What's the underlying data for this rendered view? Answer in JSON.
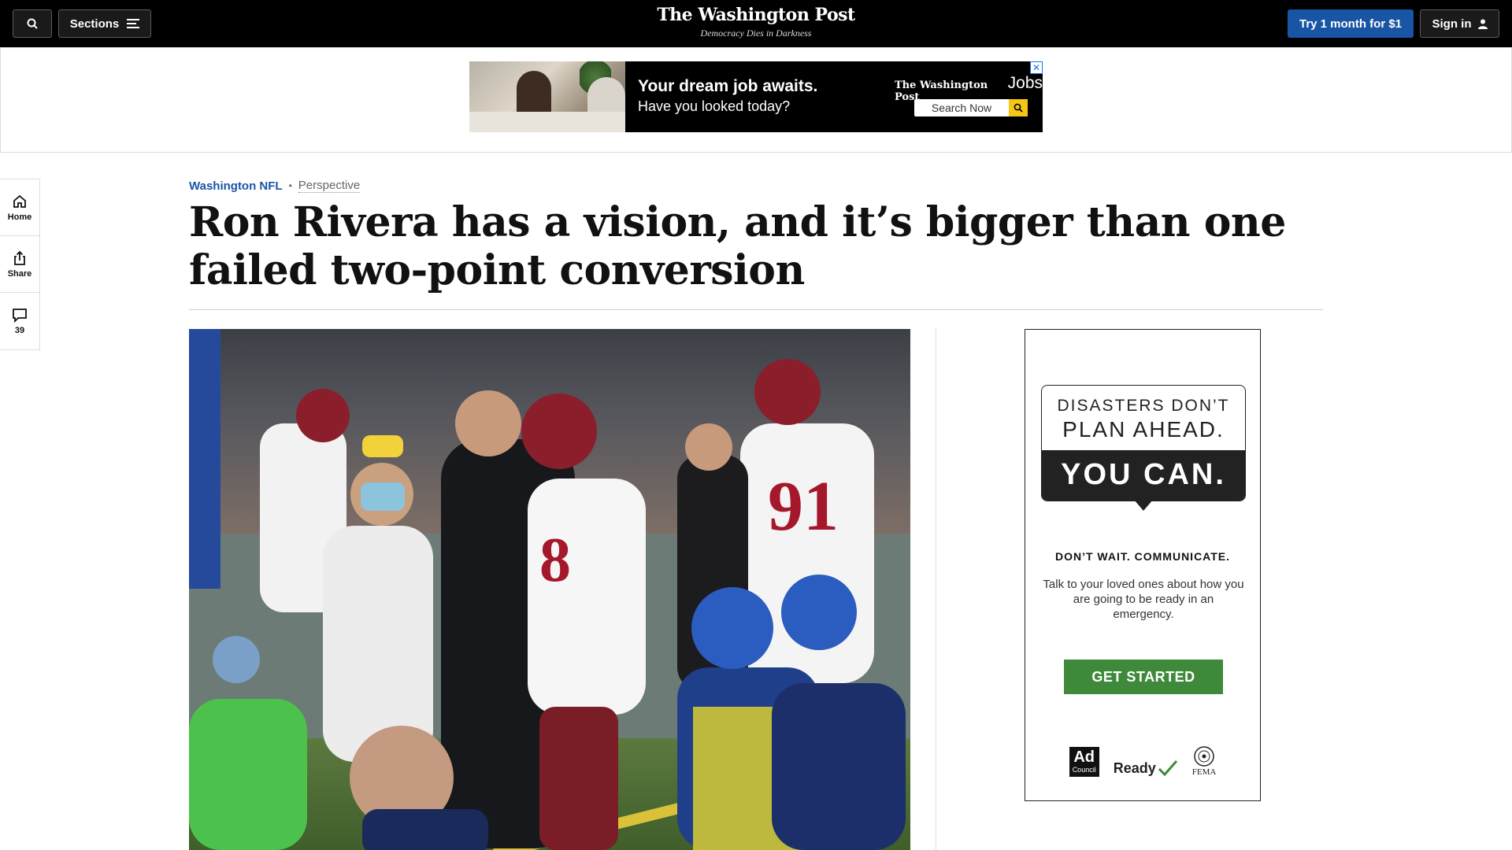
{
  "header": {
    "sections_label": "Sections",
    "logo_text": "The Washington Post",
    "tagline": "Democracy Dies in Darkness",
    "subscribe_label": "Try 1 month for $1",
    "signin_label": "Sign in"
  },
  "top_ad": {
    "headline": "Your dream job awaits.",
    "subline": "Have you looked today?",
    "brand": "The Washington Post",
    "brand_suffix": "Jobs",
    "search_label": "Search Now",
    "close_glyph": "✕"
  },
  "rail": {
    "home_label": "Home",
    "share_label": "Share",
    "comment_count": "39"
  },
  "article": {
    "section": "Washington NFL",
    "separator": "•",
    "label": "Perspective",
    "headline": "Ron Rivera has a vision, and it’s bigger than one failed two-point conversion"
  },
  "side_ad": {
    "line1": "DISASTERS DON’T",
    "line2": "PLAN AHEAD.",
    "line3": "YOU CAN.",
    "wait": "DON’T WAIT. COMMUNICATE.",
    "body": "Talk to your loved ones about how you are going to be ready in an emergency.",
    "cta": "GET STARTED",
    "logo_ad_top": "Ad",
    "logo_ad_bottom": "Council",
    "logo_ready": "Ready",
    "logo_fema": "FEMA"
  },
  "colors": {
    "brand_blue": "#1955a5",
    "cta_green": "#3e8a3a",
    "header_black": "#000000"
  }
}
